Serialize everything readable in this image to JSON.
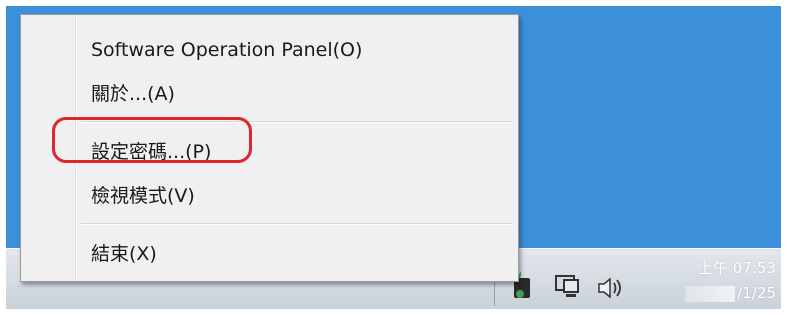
{
  "menu": {
    "items": [
      {
        "label": "Software Operation Panel(O)"
      },
      {
        "label": "關於...(A)"
      },
      {
        "label": "設定密碼...(P)"
      },
      {
        "label": "檢視模式(V)"
      },
      {
        "label": "結束(X)"
      }
    ],
    "highlighted_item": "設定密碼...(P)",
    "highlight_color": "#e0232d"
  },
  "taskbar": {
    "clock_time": "上午 07:53",
    "clock_date": "/1/25",
    "tray_icons": [
      "show-hidden-icons-arrow",
      "scanner-app-icon",
      "network-icon",
      "volume-icon"
    ]
  },
  "colors": {
    "desktop": "#3c8fd9",
    "menu_background": "#f0f0f0"
  }
}
